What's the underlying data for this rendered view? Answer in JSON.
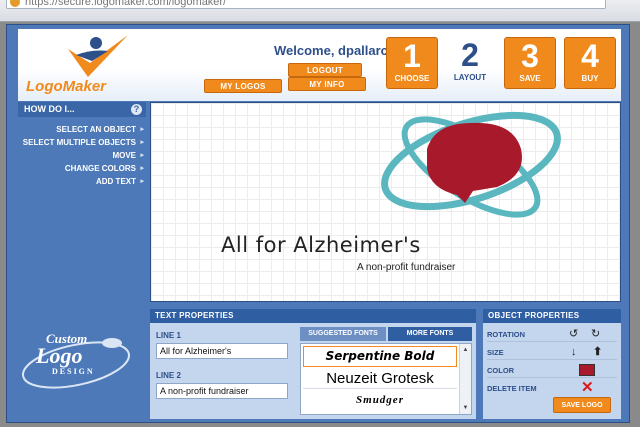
{
  "browser": {
    "url": "https://secure.logomaker.com/logomaker/"
  },
  "header": {
    "logo_text_1": "Logo",
    "logo_text_2": "Maker",
    "welcome": "Welcome, dpallarca",
    "logout_label": "LOGOUT",
    "my_logos_label": "MY LOGOS",
    "my_info_label": "MY INFO",
    "steps": [
      {
        "number": "1",
        "label": "CHOOSE"
      },
      {
        "number": "2",
        "label": "LAYOUT"
      },
      {
        "number": "3",
        "label": "SAVE"
      },
      {
        "number": "4",
        "label": "BUY"
      }
    ]
  },
  "howto": {
    "title": "HOW DO I...",
    "help": "?",
    "items": [
      "SELECT AN OBJECT",
      "SELECT MULTIPLE OBJECTS",
      "MOVE",
      "CHANGE COLORS",
      "ADD TEXT"
    ]
  },
  "canvas": {
    "title": "All for Alzheimer's",
    "subtitle": "A non-profit fundraiser",
    "colors": {
      "brain": "#a8192c",
      "orbit": "#5ab7bf"
    }
  },
  "custom_logo": {
    "line1": "Custom",
    "line2": "Logo",
    "line3": "DESIGN"
  },
  "text_properties": {
    "title": "TEXT PROPERTIES",
    "line1_label": "LINE 1",
    "line1_value": "All for Alzheimer's",
    "line2_label": "LINE 2",
    "line2_value": "A non-profit fundraiser",
    "tab_suggested": "SUGGESTED FONTS",
    "tab_more": "MORE FONTS",
    "fonts": [
      "Serpentine Bold",
      "Neuzeit Grotesk",
      "Smudger"
    ]
  },
  "object_properties": {
    "title": "OBJECT PROPERTIES",
    "rotation": "ROTATION",
    "size": "SIZE",
    "color": "COLOR",
    "delete": "DELETE ITEM",
    "save_logo": "SAVE LOGO",
    "color_value": "#a8192c"
  }
}
